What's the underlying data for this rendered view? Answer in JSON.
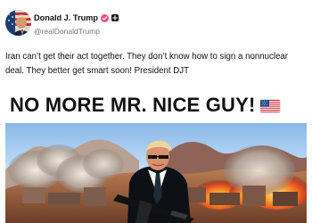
{
  "post": {
    "display_name": "Donald J. Trump",
    "handle": "@realDonaldTrump",
    "text": "Iran can’t get their act together. They don’t know how to sign a nonnuclear deal. They better get smart soon! President DJT",
    "image_headline": "NO MORE MR. NICE GUY!",
    "flag_icon": "us-flag-icon",
    "avatar_icon": "avatar-with-flag-icon",
    "verified_icon": "verified-badge-icon",
    "secondary_icon": "square-badge-icon"
  },
  "colors": {
    "verified": "#ff4d7d",
    "handle": "#777777",
    "text": "#111111",
    "sky": "#b9d5ee",
    "explosion": "#ff7d28"
  }
}
